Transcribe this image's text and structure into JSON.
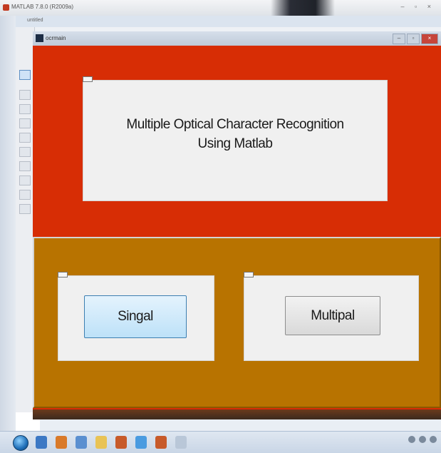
{
  "outer_window": {
    "title": "MATLAB 7.8.0 (R2009a)",
    "controls": "– ▫ ×"
  },
  "guide_window": {
    "title": "untitled"
  },
  "figure_window": {
    "title": "ocrmain",
    "controls": {
      "minimize": "–",
      "maximize": "▫",
      "close": "×"
    }
  },
  "header_panel": {
    "title_line1": "Multiple Optical Character Recognition",
    "title_line2": "Using Matlab"
  },
  "buttons": {
    "single_label": "Singal",
    "multiple_label": "Multipal"
  },
  "colors": {
    "figure_background": "#d72d05",
    "bottom_panel": "#b87300",
    "panel_gray": "#f0f0f0",
    "active_button": "#bde1f8"
  },
  "icons": [
    "select-arrow-icon",
    "pushbutton-tool-icon",
    "slider-tool-icon",
    "radio-tool-icon",
    "checkbox-tool-icon",
    "edit-text-tool-icon",
    "static-text-tool-icon",
    "popup-menu-tool-icon",
    "listbox-tool-icon",
    "toggle-tool-icon",
    "table-tool-icon",
    "axes-tool-icon"
  ]
}
